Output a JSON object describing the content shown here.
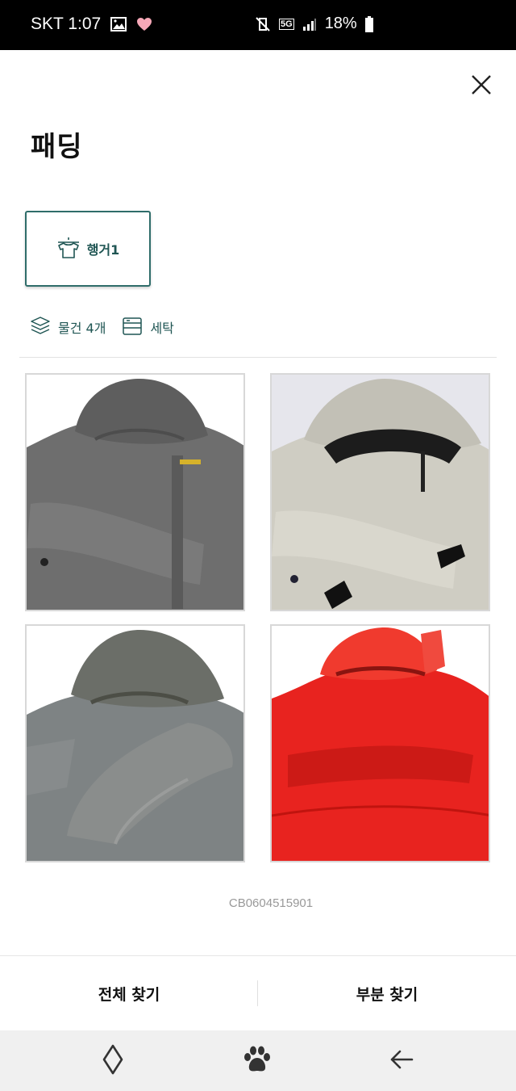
{
  "status_bar": {
    "carrier": "SKT",
    "time": "1:07",
    "network": "5G",
    "battery": "18%"
  },
  "header": {
    "title": "패딩",
    "close_icon": "close-icon"
  },
  "location": {
    "label": "행거1",
    "icon": "hanger-shirt-icon"
  },
  "meta": {
    "count_label": "물건 4개",
    "count_icon": "layers-icon",
    "service_label": "세탁",
    "service_icon": "washer-icon"
  },
  "photos": [
    {
      "description_name": "dark-gray-padded-jacket-photo",
      "color": "#6e6e6e"
    },
    {
      "description_name": "beige-padded-jacket-photo",
      "color": "#cfcdc3"
    },
    {
      "description_name": "gray-puffer-jacket-photo",
      "color": "#808080"
    },
    {
      "description_name": "red-puffer-jacket-photo",
      "color": "#e8231f"
    }
  ],
  "item_code": "CB0604515901",
  "actions": {
    "full_search": "전체 찾기",
    "partial_search": "부분 찾기"
  },
  "nav": {
    "left_icon": "diamond-icon",
    "center_icon": "paw-icon",
    "right_icon": "back-arrow-icon"
  },
  "colors": {
    "accent": "#2f6d6a",
    "status_bar": "#000000"
  }
}
